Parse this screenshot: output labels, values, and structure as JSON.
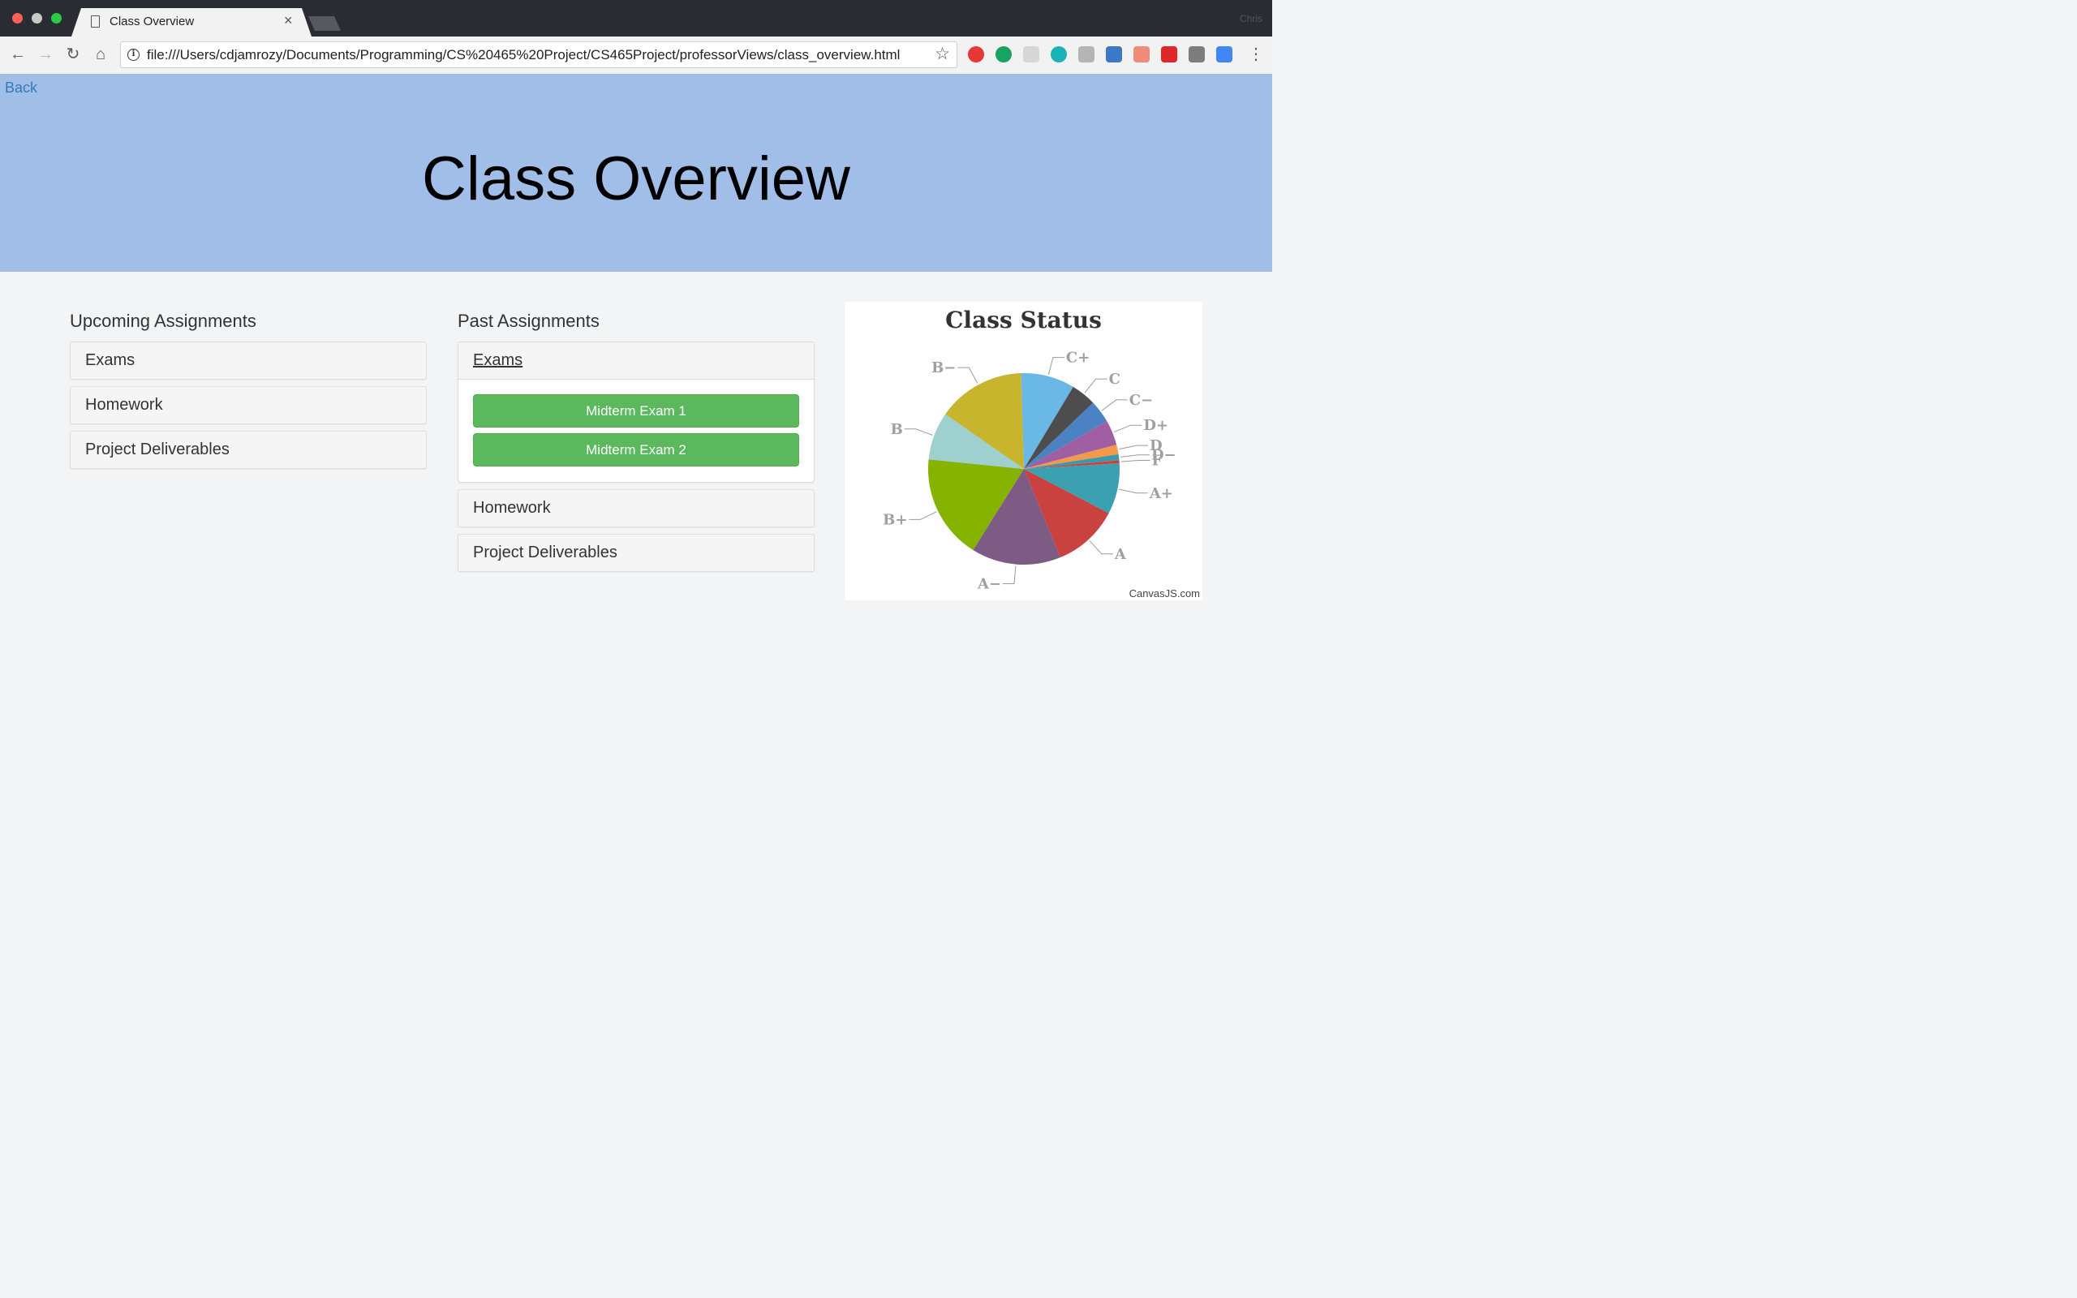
{
  "browser": {
    "tab_title": "Class Overview",
    "close_glyph": "×",
    "url": "file:///Users/cdjamrozy/Documents/Programming/CS%20465%20Project/CS465Project/professorViews/class_overview.html",
    "profile_name": "Chris"
  },
  "header": {
    "back_link": "Back",
    "title": "Class Overview",
    "background": "#a1bee8"
  },
  "upcoming": {
    "heading": "Upcoming Assignments",
    "panels": [
      "Exams",
      "Homework",
      "Project Deliverables"
    ]
  },
  "past": {
    "heading": "Past Assignments",
    "panels": [
      "Exams",
      "Homework",
      "Project Deliverables"
    ],
    "exam_buttons": [
      "Midterm Exam 1",
      "Midterm Exam 2"
    ],
    "button_color": "#5cb85c"
  },
  "chart_data": {
    "type": "pie",
    "title": "Class Status",
    "credit": "CanvasJS.com",
    "slices": [
      {
        "label": "C+",
        "value": 9,
        "color": "#6ab8e6"
      },
      {
        "label": "C",
        "value": 4.2,
        "color": "#4d4d4d"
      },
      {
        "label": "C−",
        "value": 3.8,
        "color": "#4a82c4"
      },
      {
        "label": "D+",
        "value": 4.2,
        "color": "#a15fa3"
      },
      {
        "label": "D",
        "value": 1.6,
        "color": "#f3994a"
      },
      {
        "label": "D−",
        "value": 1,
        "color": "#3a9aa9"
      },
      {
        "label": "F",
        "value": 0.5,
        "color": "#d23e3a"
      },
      {
        "label": "A+",
        "value": 8.5,
        "color": "#3ba0b0"
      },
      {
        "label": "A",
        "value": 11,
        "color": "#c9423f"
      },
      {
        "label": "A−",
        "value": 15,
        "color": "#7e5b84"
      },
      {
        "label": "B+",
        "value": 17.5,
        "color": "#85b300"
      },
      {
        "label": "B",
        "value": 8,
        "color": "#9fd0d0"
      },
      {
        "label": "B−",
        "value": 14.7,
        "color": "#c8b52e"
      }
    ]
  }
}
